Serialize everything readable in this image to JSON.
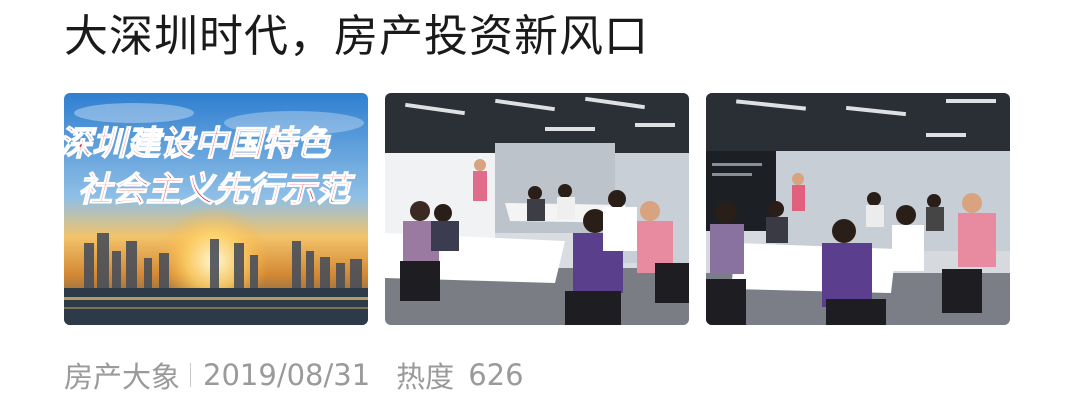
{
  "article": {
    "title": "大深圳时代，房产投资新风口",
    "source": "房产大象",
    "date": "2019/08/31",
    "heat_label": "热度",
    "heat_value": "626"
  },
  "thumbnails": [
    {
      "icon": "city-skyline-banner-image",
      "overlay_line1": "深圳建设中国特色",
      "overlay_line2": "社会主义先行示范"
    },
    {
      "icon": "seminar-room-photo"
    },
    {
      "icon": "seminar-audience-photo"
    }
  ],
  "colors": {
    "title": "#1a1a1a",
    "meta": "#9a9a9a",
    "banner_red": "#d8141c"
  }
}
